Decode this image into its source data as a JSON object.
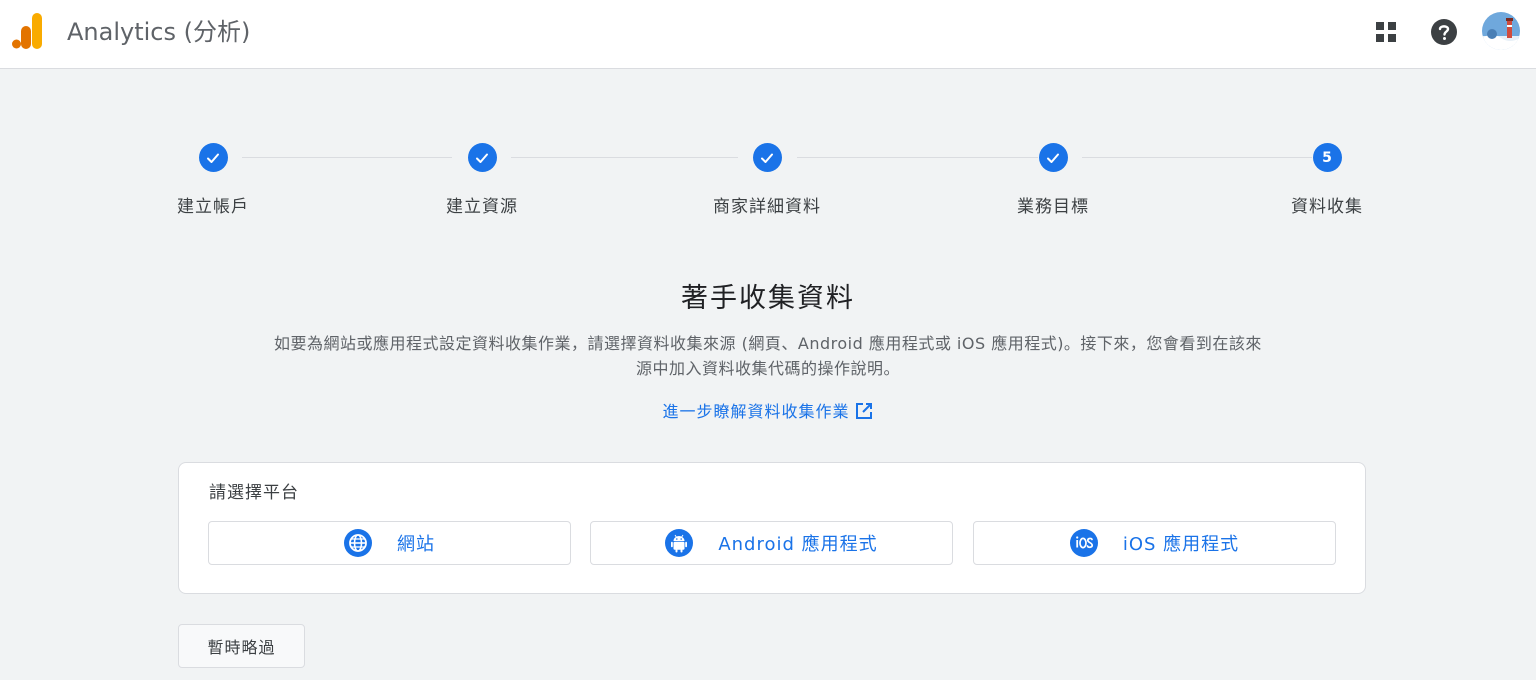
{
  "header": {
    "title": "Analytics (分析)",
    "icons": [
      "analytics-logo",
      "apps-grid-icon",
      "help-icon",
      "avatar"
    ]
  },
  "stepper": {
    "steps": [
      {
        "label": "建立帳戶",
        "state": "completed",
        "indicator": "check"
      },
      {
        "label": "建立資源",
        "state": "completed",
        "indicator": "check"
      },
      {
        "label": "商家詳細資料",
        "state": "completed",
        "indicator": "check"
      },
      {
        "label": "業務目標",
        "state": "completed",
        "indicator": "check"
      },
      {
        "label": "資料收集",
        "state": "current",
        "indicator": "5"
      }
    ]
  },
  "main": {
    "heading": "著手收集資料",
    "description": "如要為網站或應用程式設定資料收集作業，請選擇資料收集來源 (網頁、Android 應用程式或 iOS 應用程式)。接下來，您會看到在該來源中加入資料收集代碼的操作說明。",
    "learn_more": "進一步瞭解資料收集作業"
  },
  "platform_card": {
    "title": "請選擇平台",
    "buttons": [
      {
        "label": "網站",
        "icon": "globe-icon"
      },
      {
        "label": "Android 應用程式",
        "icon": "android-icon"
      },
      {
        "label": "iOS 應用程式",
        "icon": "ios-icon"
      }
    ]
  },
  "footer": {
    "skip_label": "暫時略過"
  },
  "colors": {
    "accent": "#1a73e8",
    "background": "#f1f3f4",
    "logo_orange": "#f9ab00",
    "logo_dark_orange": "#e37400"
  }
}
